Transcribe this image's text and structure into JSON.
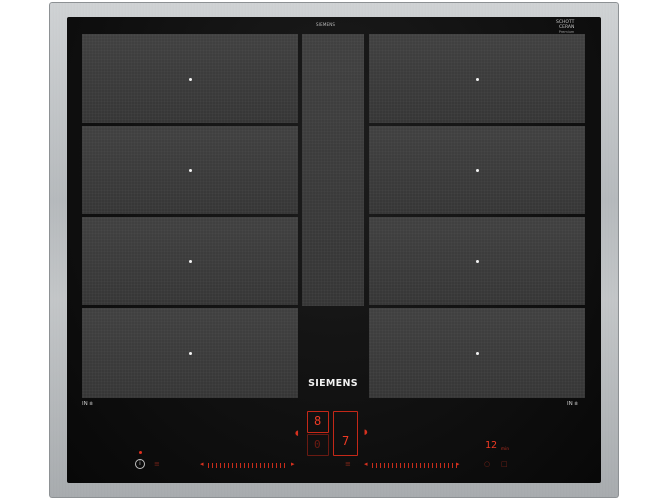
{
  "product": {
    "brand": "SIEMENS",
    "model_small": "SIEMENS",
    "glass_brand_line1": "SCHOTT",
    "glass_brand_line2": "CERAN",
    "glass_brand_line3": "Premium"
  },
  "zone_marker_left": "IN",
  "zone_marker_right": "IN",
  "controls": {
    "left_display_top": "8",
    "left_display_bottom": "0",
    "right_display": "7",
    "timer_value": "12",
    "timer_unit": "min",
    "info_symbol": "i"
  },
  "colors": {
    "glass": "#0f0f0f",
    "zone": "#3b3b3b",
    "control_red": "#e0301e",
    "frame": "#bfc2c4"
  }
}
